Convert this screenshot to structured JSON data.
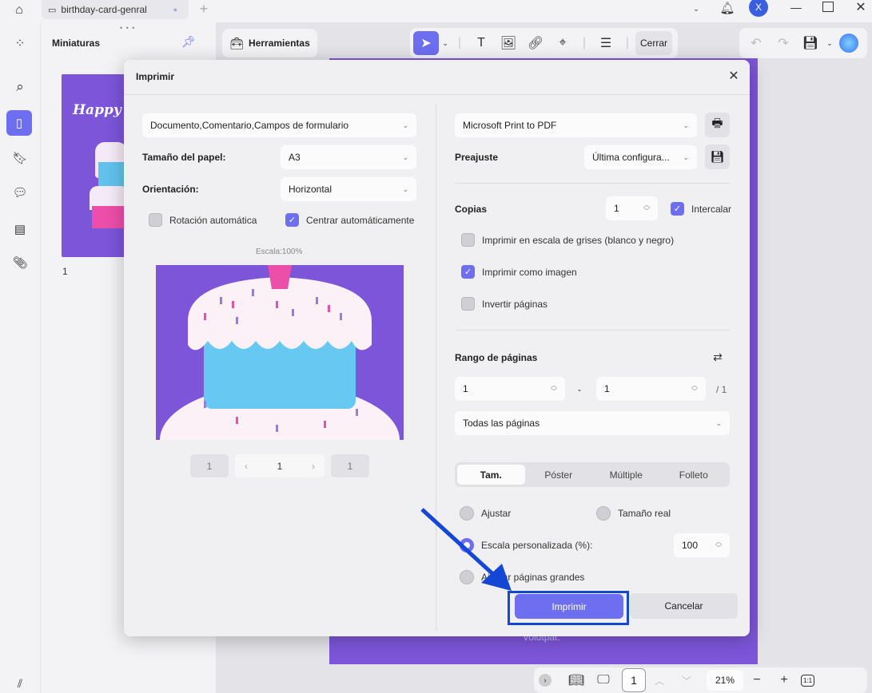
{
  "titlebar": {
    "tab_title": "birthday-card-genral",
    "avatar_letter": "X"
  },
  "sidebar": {
    "panel_title": "Miniaturas",
    "thumbnail_page": "1"
  },
  "toolbar": {
    "tools_label": "Herramientas",
    "close_label": "Cerrar"
  },
  "document": {
    "footer_text": "Volutpat."
  },
  "bottombar": {
    "page": "1",
    "zoom": "21%",
    "fit_label": "1:1"
  },
  "dialog": {
    "title": "Imprimir",
    "content_select": "Documento,Comentario,Campos de formulario",
    "paper_size_label": "Tamaño del papel:",
    "paper_size": "A3",
    "orientation_label": "Orientación:",
    "orientation": "Horizontal",
    "auto_rotate": "Rotación automática",
    "auto_center": "Centrar automáticamente",
    "scale_text": "Escala:100%",
    "pager": {
      "first": "1",
      "current": "1",
      "last": "1"
    },
    "printer": "Microsoft Print to PDF",
    "preset_label": "Preajuste",
    "preset": "Última configura...",
    "copies_label": "Copias",
    "copies": "1",
    "collate": "Intercalar",
    "grayscale": "Imprimir en escala de grises (blanco y negro)",
    "as_image": "Imprimir como imagen",
    "reverse": "Invertir páginas",
    "range_label": "Rango de páginas",
    "range_from": "1",
    "range_to": "1",
    "range_sep": "-",
    "range_total": "/ 1",
    "range_select": "Todas las páginas",
    "tabs": [
      "Tam.",
      "Póster",
      "Múltiple",
      "Folleto"
    ],
    "fit": "Ajustar",
    "actual_size": "Tamaño real",
    "custom_scale": "Escala personalizada (%):",
    "custom_scale_value": "100",
    "shrink_large": "Ajustar páginas grandes",
    "print_button": "Imprimir",
    "cancel_button": "Cancelar"
  },
  "colors": {
    "accent": "#6d6ef0",
    "highlight": "#1447d4",
    "page_bg": "#7c55d8"
  }
}
